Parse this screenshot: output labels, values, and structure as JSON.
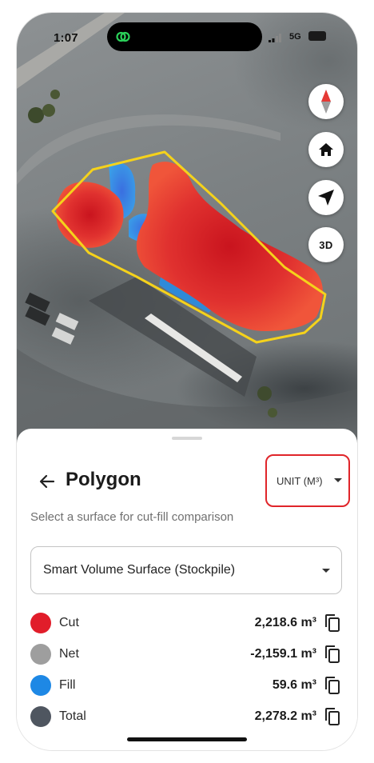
{
  "status_bar": {
    "time": "1:07",
    "network": "5G",
    "app_icon": "link-rings-icon"
  },
  "map": {
    "buttons": [
      {
        "name": "compass",
        "icon": "compass-icon"
      },
      {
        "name": "home",
        "icon": "home-icon"
      },
      {
        "name": "locate",
        "icon": "navigation-arrow-icon"
      },
      {
        "name": "3d",
        "label": "3D"
      }
    ],
    "colors": {
      "boundary": "#f5d21b",
      "cut": "#e53935",
      "fill": "#2f8ad8"
    }
  },
  "panel": {
    "title": "Polygon",
    "unit_label": "UNIT (M³)",
    "subtitle": "Select a surface for cut-fill comparison",
    "surface_select": {
      "value": "Smart Volume Surface (Stockpile)"
    },
    "metrics": [
      {
        "label": "Cut",
        "value": "2,218.6 m³",
        "color": "#e11d2a"
      },
      {
        "label": "Net",
        "value": "-2,159.1 m³",
        "color": "#9e9e9e"
      },
      {
        "label": "Fill",
        "value": "59.6 m³",
        "color": "#1e88e5"
      },
      {
        "label": "Total",
        "value": "2,278.2 m³",
        "color": "#4f5660"
      }
    ]
  },
  "colors": {
    "highlight_border": "#e0252a"
  }
}
